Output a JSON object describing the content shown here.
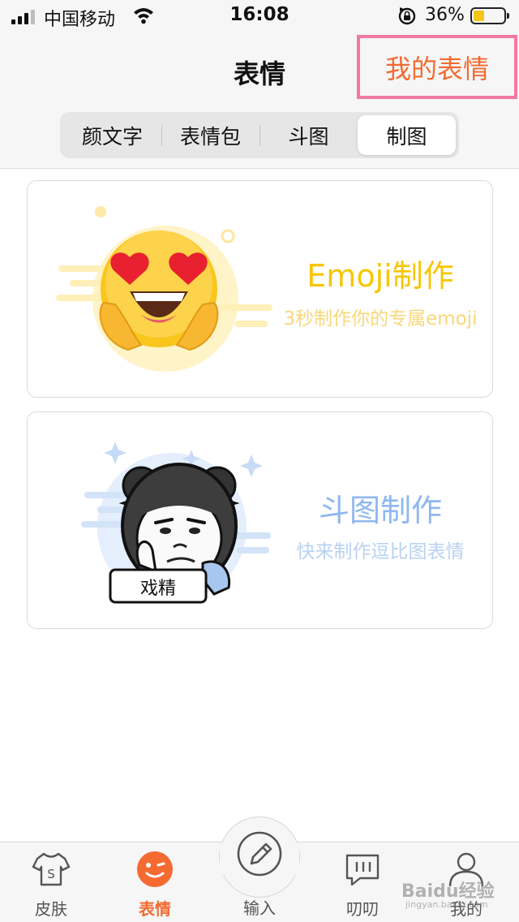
{
  "status_bar": {
    "carrier": "中国移动",
    "time": "16:08",
    "battery_percent": "36%",
    "battery_level": 0.36
  },
  "header": {
    "title": "表情",
    "my_emoji_button": "我的表情",
    "my_emoji_highlight_color": "#f07aa0",
    "accent_color": "#f46a31"
  },
  "segments": [
    {
      "label": "颜文字",
      "active": false
    },
    {
      "label": "表情包",
      "active": false
    },
    {
      "label": "斗图",
      "active": false
    },
    {
      "label": "制图",
      "active": true
    }
  ],
  "cards": [
    {
      "title": "Emoji制作",
      "subtitle": "3秒制作你的专属emoji",
      "icon": "heart-eyes-emoji-icon",
      "color": "#f7c600"
    },
    {
      "title": "斗图制作",
      "subtitle": "快来制作逗比图表情",
      "icon": "meme-face-icon",
      "sticker_text": "戏精",
      "color": "#8fb8ef"
    }
  ],
  "tab_bar": [
    {
      "label": "皮肤",
      "icon": "shirt-icon",
      "active": false
    },
    {
      "label": "表情",
      "icon": "wink-face-icon",
      "active": true
    },
    {
      "label": "输入",
      "icon": "pencil-icon",
      "active": false
    },
    {
      "label": "叨叨",
      "icon": "chat-bubble-icon",
      "active": false
    },
    {
      "label": "我的",
      "icon": "person-icon",
      "active": false
    }
  ],
  "watermark": {
    "text": "Baidu经验",
    "sub": "jingyan.baidu.com"
  }
}
